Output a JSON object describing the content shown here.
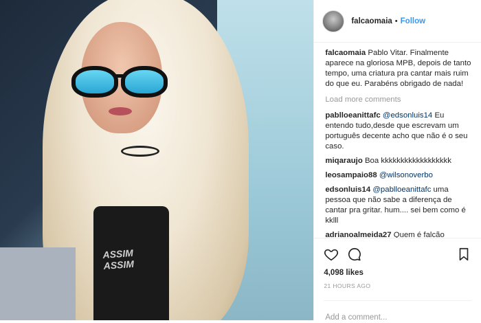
{
  "post": {
    "username": "falcaomaia",
    "separator": "•",
    "follow_label": "Follow",
    "caption": {
      "user": "falcaomaia",
      "text": "Pablo Vitar. Finalmente aparece na gloriosa MPB, depois de tanto tempo, uma criatura pra cantar mais ruim do que eu. Parabéns obrigado de nada!"
    },
    "load_more_label": "Load more comments",
    "comments": [
      {
        "user": "pablloeanittafc",
        "mention": "@edsonluis14",
        "text": " Eu entendo tudo,desde que escrevam um português decente acho que não é o seu caso."
      },
      {
        "user": "miqaraujo",
        "mention": "",
        "text": "Boa kkkkkkkkkkkkkkkkkk"
      },
      {
        "user": "leosampaio88",
        "mention": "@wilsonoverbo",
        "text": ""
      },
      {
        "user": "edsonluis14",
        "mention": "@pablloeanittafc",
        "text": " uma pessoa que não sabe a diferença de cantar pra gritar. hum.... sei bem como é kklll"
      },
      {
        "user": "adrianoalmeida27",
        "mention": "",
        "text": "Quem é falcão mesmo? Ah tá um ser que independente das piadas sem graças e muito idiotas fez sucesso a uma longa data láááá atrás...Quem é esse critico musical? Quer aparecer nas custas"
      }
    ],
    "likes": "4,098 likes",
    "timestamp": "21 HOURS AGO",
    "comment_placeholder": "Add a comment...",
    "photo_print_text": "ASSIM ASSIM"
  },
  "colors": {
    "link": "#3897f0",
    "mention": "#003569",
    "muted": "#999999"
  },
  "icons": [
    "heart-icon",
    "comment-icon",
    "bookmark-icon"
  ]
}
